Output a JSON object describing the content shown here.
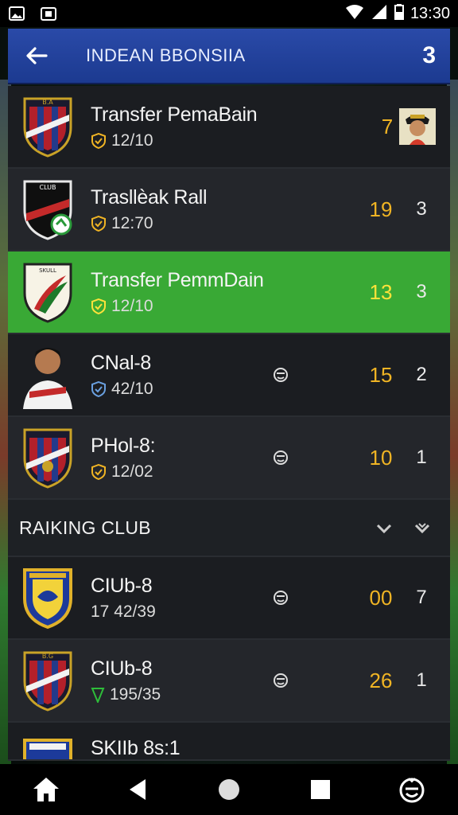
{
  "status_bar": {
    "time": "13:30",
    "icons": [
      "image-icon",
      "screenshot-icon",
      "wifi-icon",
      "signal-icon",
      "battery-icon"
    ]
  },
  "header": {
    "title": "INDEAN BBONSIIA",
    "count": "3",
    "back_icon": "arrow-left-icon"
  },
  "rows": [
    {
      "title": "Transfer PemaBain",
      "sub": "12/10",
      "score": "7",
      "rank": "",
      "has_avatar": true,
      "crest": "crest-red-blue"
    },
    {
      "title": "Trasllèak Rall",
      "sub": "12:70",
      "score": "19",
      "rank": "3",
      "has_avatar": false,
      "crest": "crest-black-red"
    },
    {
      "title": "Transfer PemmDain",
      "sub": "12/10",
      "score": "13",
      "rank": "3",
      "has_avatar": false,
      "crest": "crest-white-green",
      "highlight": true
    },
    {
      "title": "CNal-8",
      "sub": "42/10",
      "score": "15",
      "rank": "2",
      "has_avatar": false,
      "crest": "player-photo",
      "mid_icon": true
    },
    {
      "title": "PHol-8:",
      "sub": "12/02",
      "score": "10",
      "rank": "1",
      "has_avatar": false,
      "crest": "crest-red-blue",
      "mid_icon": true
    }
  ],
  "section": {
    "title": "RAIKING CLUB"
  },
  "club_rows": [
    {
      "title": "CIUb-8",
      "sub": "17 42/39",
      "score": "00",
      "rank": "7",
      "crest": "crest-blue-yellow",
      "mid_icon": true
    },
    {
      "title": "CIUb-8",
      "sub": "195/35",
      "score": "26",
      "rank": "1",
      "crest": "crest-red-blue",
      "mid_icon": true
    },
    {
      "title": "SKIIb 8s:1",
      "sub": "",
      "score": "",
      "rank": "",
      "crest": "crest-blue-yellow"
    }
  ],
  "nav": [
    "home-icon",
    "back-triangle-icon",
    "home-circle-icon",
    "recents-square-icon",
    "assistant-icon"
  ],
  "colors": {
    "header_blue": "#1c3a90",
    "highlight_green": "#39a935",
    "score_gold": "#f0b424"
  }
}
